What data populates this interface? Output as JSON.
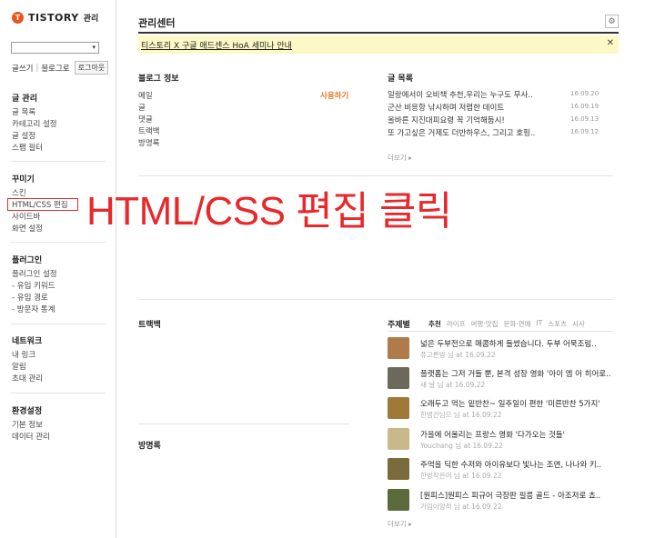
{
  "sidebar": {
    "logo_badge": "T",
    "logo_text": "TISTORY",
    "logo_sub": "관리",
    "select_arrow": "▾",
    "links": [
      "글쓰기",
      "블로그로"
    ],
    "logout": "로그아웃",
    "groups": [
      {
        "title": "글 관리",
        "items": [
          "글 목록",
          "카테고리 설정",
          "글 설정",
          "스팸 필터"
        ]
      },
      {
        "title": "꾸미기",
        "items": [
          "스킨",
          "HTML/CSS 편집",
          "사이드바",
          "화면 설정"
        ]
      },
      {
        "title": "플러그인",
        "items": [
          "플러그인 설정",
          "- 유입 키워드",
          "- 유입 경로",
          "- 방문자 통계"
        ]
      },
      {
        "title": "네트워크",
        "items": [
          "내 링크",
          "알림",
          "초대 관리"
        ]
      },
      {
        "title": "환경설정",
        "items": [
          "기본 정보",
          "데이터 관리"
        ]
      }
    ]
  },
  "main": {
    "title": "관리센터",
    "gear_icon": "⚙",
    "notice": "티스토리 X 구글 애드센스 HoA 세미나 안내",
    "notice_close": "✕",
    "blog_info": {
      "title": "블로그 정보",
      "rows": [
        "메일",
        "글",
        "댓글",
        "트랙백",
        "방명록"
      ],
      "usage": "사용하기"
    },
    "posts": {
      "title": "글 목록",
      "items": [
        {
          "title": "일랑에서이 오비책 추천,우리는 누구도 무사..",
          "date": "16.09.20"
        },
        {
          "title": "군산 비응항 낚시하며 저렴한 데이트",
          "date": "16.09.19"
        },
        {
          "title": "올바른 지진대피요령 꼭 기억해둡시!",
          "date": "16.09.13"
        },
        {
          "title": "또 가고싶은 거제도 더반하우스, 그리고 호핑..",
          "date": "16.09.12"
        }
      ],
      "more": "더보기 ▸"
    },
    "trackback": {
      "title": "트랙백"
    },
    "guestbook": {
      "title": "방명록"
    },
    "themes": {
      "title": "주제별",
      "tabs": [
        "추천",
        "라이프",
        "여행·맛집",
        "문화·연예",
        "IT",
        "스포츠",
        "시사"
      ],
      "items": [
        {
          "title": "넓은 두부전으로 매콤하게 들썼습니다. 두부 어묵조림..",
          "meta": "퓨고른방 님 at 16.09.22",
          "color": "#b07a4a"
        },
        {
          "title": "플랫폼는 그저 거들 뿐, 본격 성장 영화 '아이 엠 어 히어로..",
          "meta": "새 날 님 at 16.09.22",
          "color": "#6b6a5a"
        },
        {
          "title": "오래두고 먹는 밑반찬~ 일주일이 편한 '미른반찬 5가지'",
          "meta": "한범건님으 님 at 16.09.22",
          "color": "#a07838"
        },
        {
          "title": "가을에 어울리는 프랑스 영화 '다가오는 것들'",
          "meta": "Youchang 님 at 16.09.22",
          "color": "#c9b98a"
        },
        {
          "title": "주먹을 딕한 수저와 아이유보다 빛나는 조연, 나나와 키..",
          "meta": "한방작은어 님 at 16.09.22",
          "color": "#7b6a3c"
        },
        {
          "title": "[원피스]원피스 피규어 극장판 필름 골드 - 아조저로 쵸..",
          "meta": "가임이양적 님 at 16.09.22",
          "color": "#5a6a3a"
        }
      ],
      "more": "더보기 ▸"
    }
  },
  "annotation": {
    "text": "HTML/CSS 편집 클릭"
  }
}
